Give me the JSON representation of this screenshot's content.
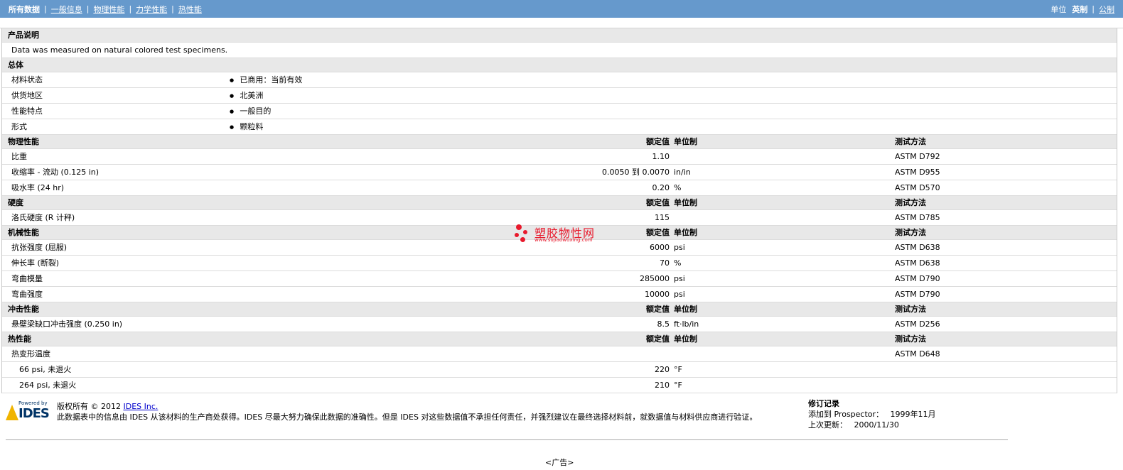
{
  "nav": {
    "tabs": [
      "所有数据",
      "一般信息",
      "物理性能",
      "力学性能",
      "热性能"
    ],
    "units_label": "单位",
    "units_selected": "英制",
    "units_other": "公制"
  },
  "description": {
    "title": "产品说明",
    "text": "Data was measured on natural colored test specimens."
  },
  "general": {
    "title": "总体",
    "rows": [
      {
        "label": "材料状态",
        "value": "已商用：当前有效"
      },
      {
        "label": "供货地区",
        "value": "北美洲"
      },
      {
        "label": "性能特点",
        "value": "一般目的"
      },
      {
        "label": "形式",
        "value": "颗粒料"
      }
    ]
  },
  "headers": {
    "rated": "额定值",
    "unit": "单位制",
    "test": "测试方法"
  },
  "sections": [
    {
      "title": "物理性能",
      "rows": [
        {
          "label": "比重",
          "value": "1.10",
          "unit": "",
          "test": "ASTM D792"
        },
        {
          "label": "收缩率 - 流动 (0.125 in)",
          "value": "0.0050 到 0.0070",
          "unit": "in/in",
          "test": "ASTM D955"
        },
        {
          "label": "吸水率 (24 hr)",
          "value": "0.20",
          "unit": "%",
          "test": "ASTM D570"
        }
      ]
    },
    {
      "title": "硬度",
      "rows": [
        {
          "label": "洛氏硬度 (R 计秤)",
          "value": "115",
          "unit": "",
          "test": "ASTM D785"
        }
      ]
    },
    {
      "title": "机械性能",
      "rows": [
        {
          "label": "抗张强度 (屈服)",
          "value": "6000",
          "unit": "psi",
          "test": "ASTM D638"
        },
        {
          "label": "伸长率 (断裂)",
          "value": "70",
          "unit": "%",
          "test": "ASTM D638"
        },
        {
          "label": "弯曲模量",
          "value": "285000",
          "unit": "psi",
          "test": "ASTM D790"
        },
        {
          "label": "弯曲强度",
          "value": "10000",
          "unit": "psi",
          "test": "ASTM D790"
        }
      ]
    },
    {
      "title": "冲击性能",
      "rows": [
        {
          "label": "悬壁梁缺口冲击强度 (0.250 in)",
          "value": "8.5",
          "unit": "ft·lb/in",
          "test": "ASTM D256"
        }
      ]
    },
    {
      "title": "热性能",
      "rows": [
        {
          "label": "热变形温度",
          "value": "",
          "unit": "",
          "test": "ASTM D648"
        },
        {
          "label": "66 psi, 未退火",
          "value": "220",
          "unit": "°F",
          "test": "",
          "sub": true
        },
        {
          "label": "264 psi, 未退火",
          "value": "210",
          "unit": "°F",
          "test": "",
          "sub": true
        }
      ]
    }
  ],
  "watermark": {
    "title": "塑胶物性网",
    "url": "www.sujiaowuxing.com"
  },
  "footer": {
    "logo_powered": "Powered by",
    "logo_name": "IDES",
    "copyright_prefix": "版权所有 © 2012",
    "copyright_link": "IDES Inc.",
    "disclaimer": "此数据表中的信息由 IDES 从该材料的生产商处获得。IDES 尽最大努力确保此数据的准确性。但是 IDES 对这些数据值不承担任何责任，并强烈建议在最终选择材料前，就数据值与材料供应商进行验证。",
    "revision_title": "修订记录",
    "added_label": "添加到 Prospector：",
    "added_value": "1999年11月",
    "updated_label": "上次更新：",
    "updated_value": "2000/11/30"
  },
  "ad_label": "<广告>"
}
